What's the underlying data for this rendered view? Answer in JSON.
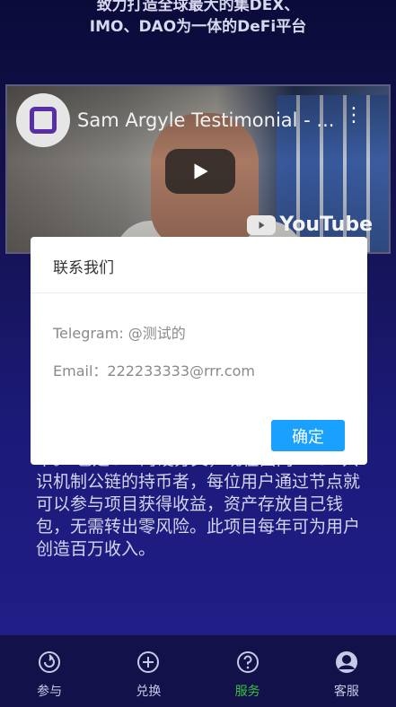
{
  "hero": {
    "subtitle_line1": "致力打造全球最大的集DEX、",
    "subtitle_line2": "IMO、DAO为一体的DeFi平台"
  },
  "video": {
    "title": "Sam Argyle Testimonial - ...",
    "brand": "YouTube",
    "icons": [
      "channel-logo-icon",
      "more-vertical-icon",
      "play-icon",
      "youtube-icon"
    ]
  },
  "intro": {
    "text": "本。 也是UNI的硬分叉，现在面向TRON共识机制公链的持币者，每位用户通过节点就可以参与项目获得收益，资产存放自己钱包，无需转出零风险。此项目每年可为用户创造百万收入。"
  },
  "dialog": {
    "title": "联系我们",
    "telegram": "Telegram: @测试的",
    "email": "Email：222233333@rrr.com",
    "confirm_label": "确定"
  },
  "tabbar": {
    "items": [
      {
        "label": "参与",
        "icon": "refresh-icon",
        "active": false
      },
      {
        "label": "兑换",
        "icon": "plus-circle-icon",
        "active": false
      },
      {
        "label": "服务",
        "icon": "help-circle-icon",
        "active": true
      },
      {
        "label": "客服",
        "icon": "user-icon",
        "active": false
      }
    ],
    "active_color": "#36c23d"
  },
  "colors": {
    "confirm_button": "#1aa0ff",
    "background_top": "#0b0b3a",
    "background_bottom": "#221f8c"
  }
}
